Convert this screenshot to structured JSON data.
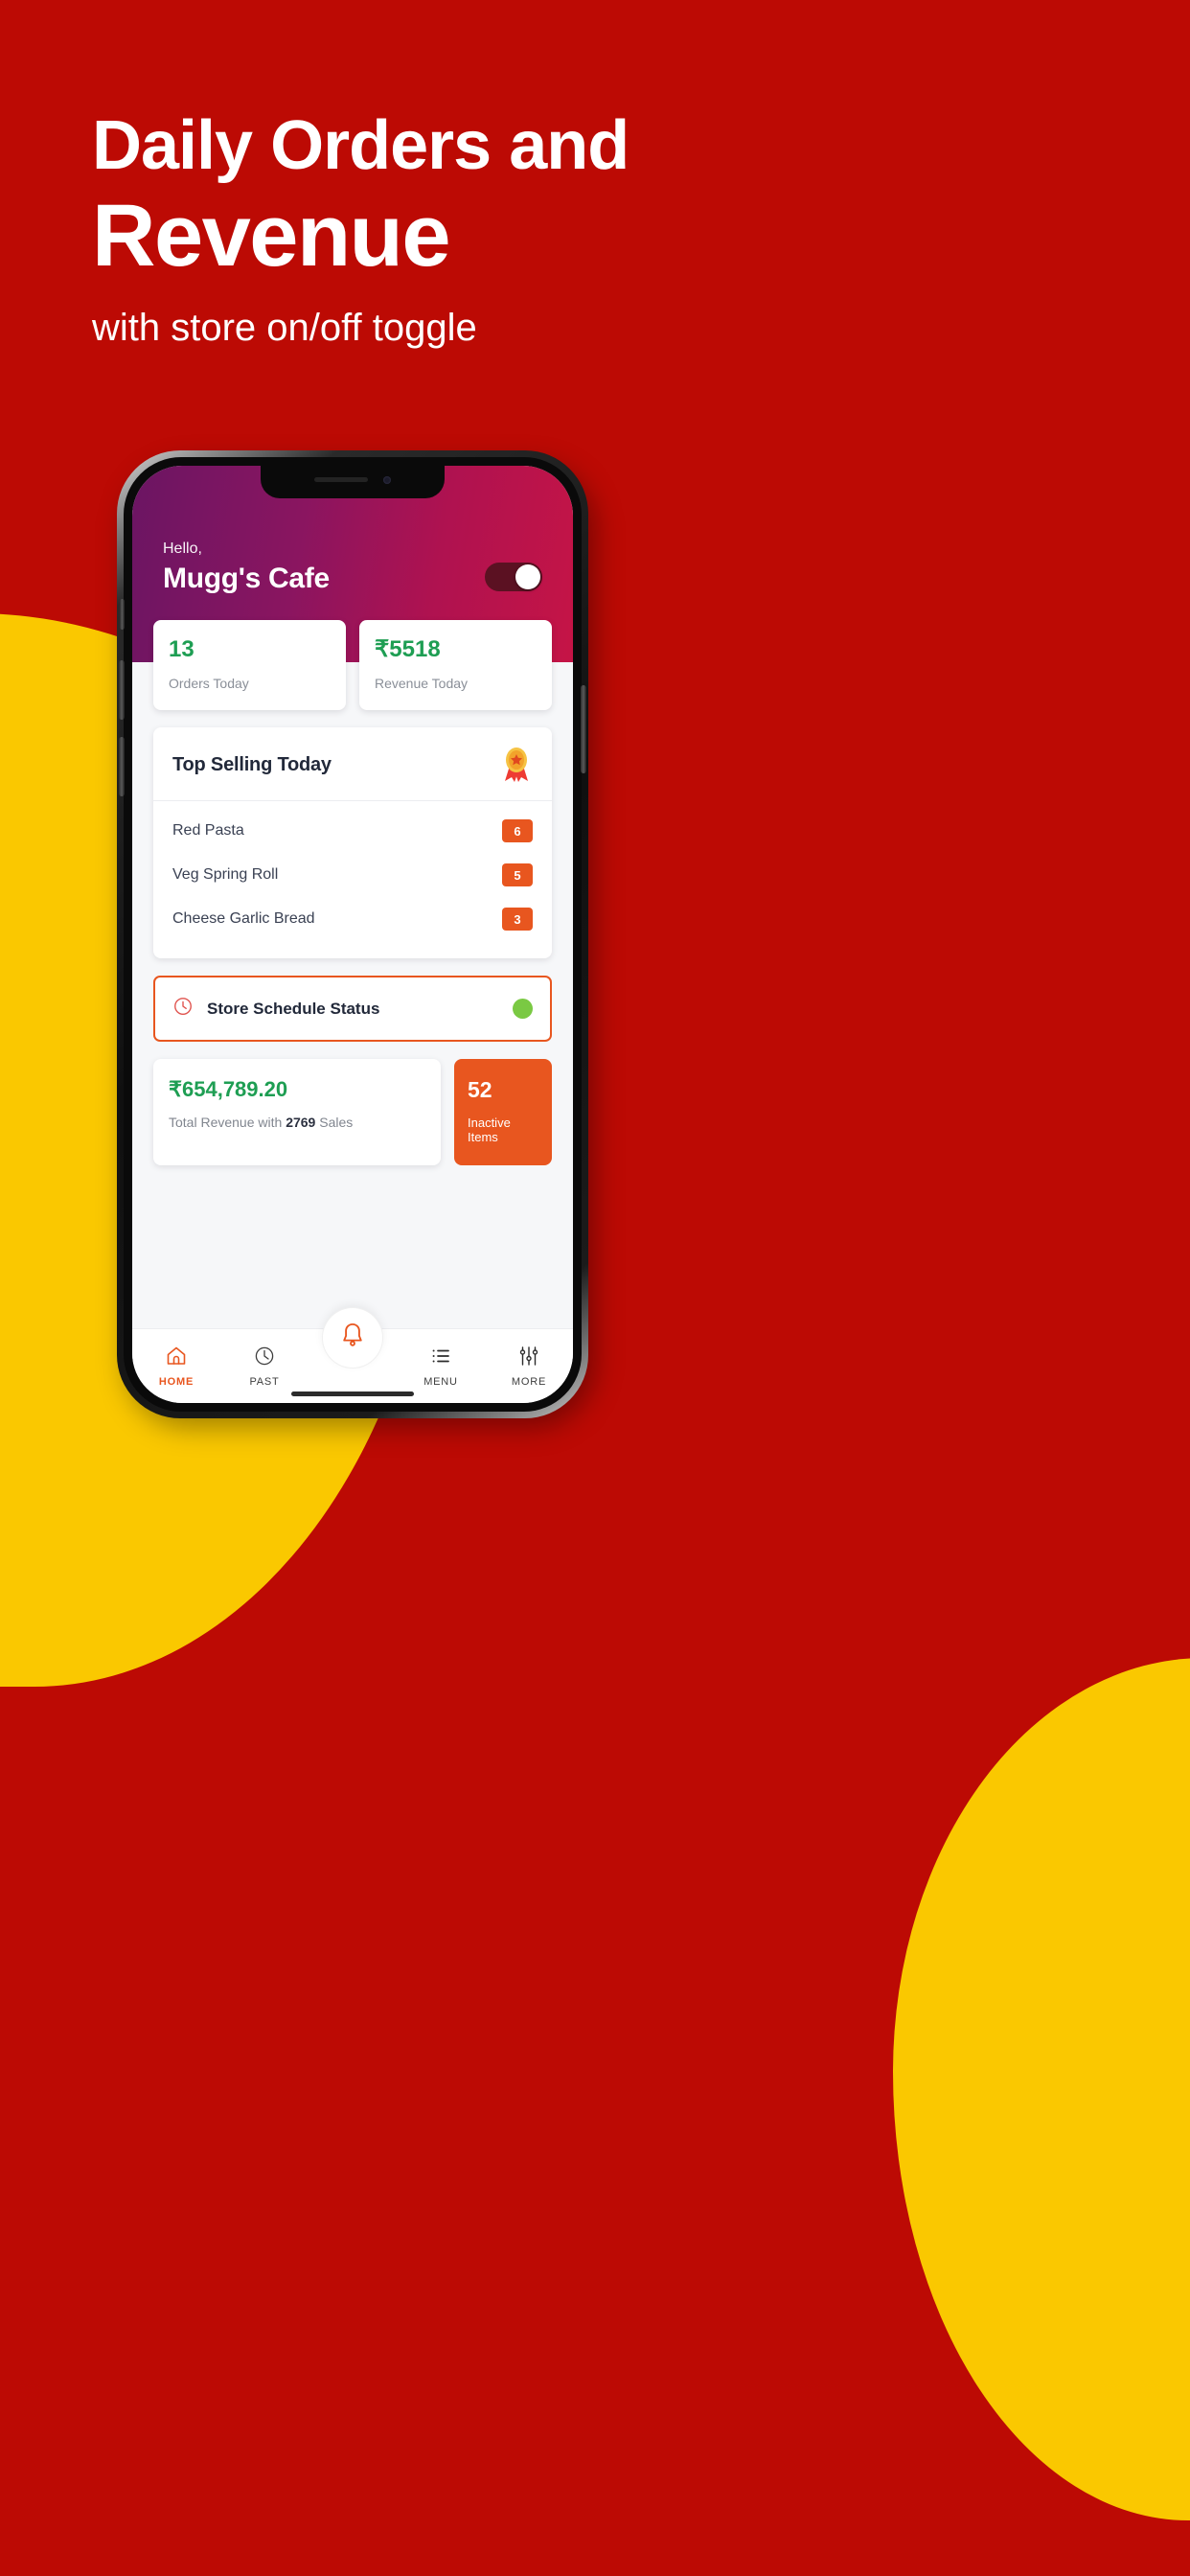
{
  "promo": {
    "headline_line1": "Daily Orders and",
    "headline_line2": "Revenue",
    "subtitle": "with store on/off toggle",
    "background_color": "#BC0A04",
    "accent_color": "#FAC800"
  },
  "app": {
    "header": {
      "greeting": "Hello,",
      "store_name": "Mugg's Cafe",
      "store_toggle": {
        "state": "on",
        "label": "store-online-toggle"
      }
    },
    "stats": [
      {
        "value": "13",
        "label": "Orders Today",
        "color": "#1E9E53"
      },
      {
        "value": "₹5518",
        "label": "Revenue Today",
        "color": "#1E9E53"
      }
    ],
    "top_selling": {
      "title": "Top Selling Today",
      "icon": "medal-icon",
      "items": [
        {
          "name": "Red Pasta",
          "count": "6"
        },
        {
          "name": "Veg Spring Roll",
          "count": "5"
        },
        {
          "name": "Cheese Garlic Bread",
          "count": "3"
        }
      ],
      "badge_color": "#E8561F"
    },
    "schedule": {
      "label": "Store Schedule Status",
      "icon": "clock-icon",
      "status_color": "#7AC943",
      "border_color": "#E8561F"
    },
    "totals": {
      "revenue": "₹654,789.20",
      "sub_prefix": "Total Revenue with ",
      "sub_count": "2769",
      "sub_suffix": " Sales",
      "inactive_value": "52",
      "inactive_label": "Inactive Items",
      "inactive_color": "#E8561F"
    },
    "nav": {
      "items": [
        {
          "label": "HOME",
          "icon": "home-icon",
          "active": true
        },
        {
          "label": "PAST",
          "icon": "clock-icon",
          "active": false
        },
        {
          "label": "MENU",
          "icon": "list-icon",
          "active": false
        },
        {
          "label": "MORE",
          "icon": "sliders-icon",
          "active": false
        }
      ],
      "fab_icon": "bell-icon",
      "active_color": "#E8561F"
    }
  }
}
